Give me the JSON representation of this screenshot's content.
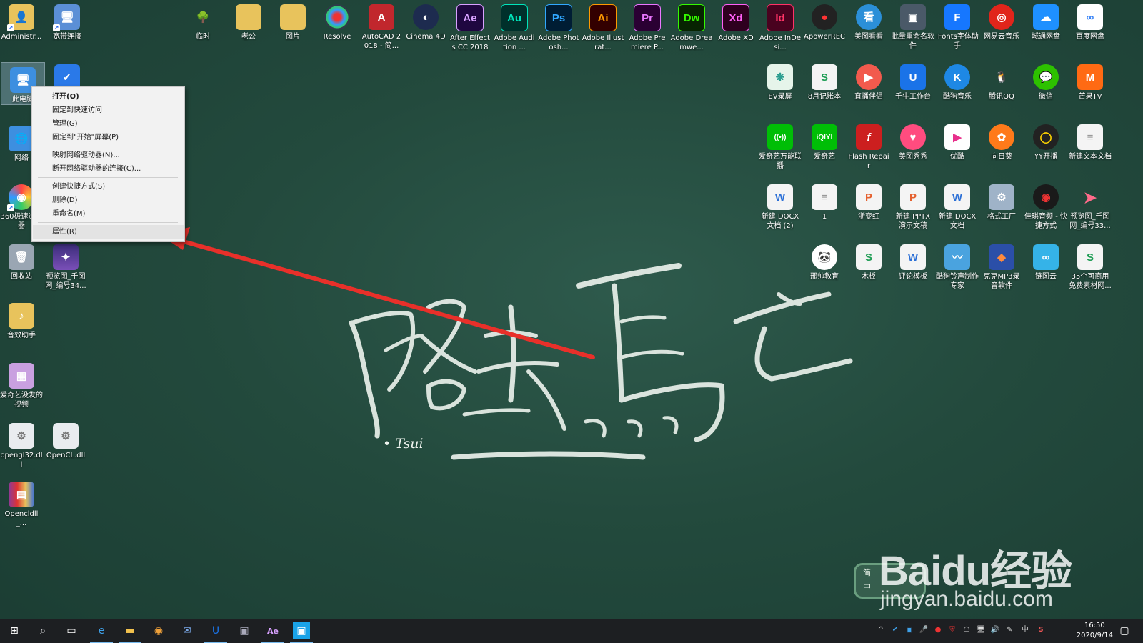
{
  "desktop_icons": [
    {
      "label": "Administr...",
      "name": "administrator-folder-icon",
      "color": "#e8c35c",
      "glyph": "👤"
    },
    {
      "label": "宽带连接",
      "name": "broadband-connection-icon",
      "color": "#5b8fd6",
      "glyph": "🖥"
    },
    {
      "label": "此电脑",
      "name": "this-pc-icon",
      "color": "#3d8fe0",
      "glyph": "🖥"
    },
    {
      "label": "网络",
      "name": "network-icon",
      "color": "#3d8fe0",
      "glyph": "🌐"
    },
    {
      "label": "360极速浏览器",
      "name": "360-browser-icon",
      "color": "#f0a13a",
      "glyph": "◉"
    },
    {
      "label": "回收站",
      "name": "recycle-bin-icon",
      "color": "#9aa6b3",
      "glyph": "🗑"
    },
    {
      "label": "预览图_千图网_编号34...",
      "name": "preview-image-galaxy-icon",
      "color": "#3b2d7a",
      "glyph": "✦"
    },
    {
      "label": "音效助手",
      "name": "sound-effect-folder-icon",
      "color": "#e8c35c",
      "glyph": "♪"
    },
    {
      "label": "爱奇艺没发的视频",
      "name": "iqiyi-videos-folder-icon",
      "color": "#c9a0e0",
      "glyph": "▦"
    },
    {
      "label": "opengl32.dll",
      "name": "opengl-dll-icon",
      "color": "#e9ecef",
      "glyph": "⚙"
    },
    {
      "label": "OpenCL.dll",
      "name": "opencl-dll-icon",
      "color": "#e9ecef",
      "glyph": "⚙"
    },
    {
      "label": "Opencldll_...",
      "name": "winrar-archive-icon",
      "color": "#8a3a9c",
      "glyph": "▤"
    },
    {
      "label": "",
      "name": "tencent-pc-manager-icon",
      "color": "#2a79e8",
      "glyph": "✓"
    },
    {
      "label": "临时",
      "name": "temp-tree-icon",
      "color": "#3f8d2e",
      "glyph": "🌳"
    },
    {
      "label": "老公",
      "name": "folder-laogong-icon",
      "color": "#e8c35c",
      "glyph": "▯"
    },
    {
      "label": "图片",
      "name": "folder-pictures-icon",
      "color": "#e8c35c",
      "glyph": "▯"
    },
    {
      "label": "Resolve",
      "name": "davinci-resolve-icon",
      "color": "#2f3a4a",
      "glyph": "◎"
    },
    {
      "label": "AutoCAD 2018 - 简...",
      "name": "autocad-icon",
      "color": "#c1272d",
      "glyph": "A"
    },
    {
      "label": "Cinema 4D",
      "name": "cinema4d-icon",
      "color": "#1d2b4f",
      "glyph": "◐"
    },
    {
      "label": "After Effects CC 2018",
      "name": "after-effects-icon",
      "color": "#1f0740",
      "glyph": "Ae"
    },
    {
      "label": "Adobe Audition ...",
      "name": "audition-icon",
      "color": "#00302b",
      "glyph": "Au"
    },
    {
      "label": "Adobe Photosh...",
      "name": "photoshop-icon",
      "color": "#001d34",
      "glyph": "Ps"
    },
    {
      "label": "Adobe Illustrat...",
      "name": "illustrator-icon",
      "color": "#330000",
      "glyph": "Ai"
    },
    {
      "label": "Adobe Premiere P...",
      "name": "premiere-icon",
      "color": "#2a0033",
      "glyph": "Pr"
    },
    {
      "label": "Adobe Dreamwe...",
      "name": "dreamweaver-icon",
      "color": "#072401",
      "glyph": "Dw"
    },
    {
      "label": "Adobe XD",
      "name": "adobe-xd-icon",
      "color": "#2e001f",
      "glyph": "Xd"
    },
    {
      "label": "Adobe InDesi...",
      "name": "indesign-icon",
      "color": "#49021f",
      "glyph": "Id"
    },
    {
      "label": "ApowerREC",
      "name": "apowerrec-icon",
      "color": "#222222",
      "glyph": "●"
    },
    {
      "label": "美图看看",
      "name": "meitu-viewer-icon",
      "color": "#2b8fd8",
      "glyph": "看"
    },
    {
      "label": "批量重命名软件",
      "name": "batch-rename-icon",
      "color": "#4a5968",
      "glyph": "▣"
    },
    {
      "label": "iFonts字体助手",
      "name": "ifonts-icon",
      "color": "#1677ff",
      "glyph": "F"
    },
    {
      "label": "网易云音乐",
      "name": "netease-music-icon",
      "color": "#e1251b",
      "glyph": "◎"
    },
    {
      "label": "城通网盘",
      "name": "ctfile-icon",
      "color": "#1e90ff",
      "glyph": "☁"
    },
    {
      "label": "百度网盘",
      "name": "baidu-netdisk-icon",
      "color": "#ffffff",
      "glyph": "∞"
    },
    {
      "label": "EV录屏",
      "name": "ev-recorder-icon",
      "color": "#e6f4ea",
      "glyph": "❋"
    },
    {
      "label": "8月记账本",
      "name": "ledger-xlsx-icon",
      "color": "#f4f4f4",
      "glyph": "S"
    },
    {
      "label": "直播伴侣",
      "name": "live-companion-icon",
      "color": "#f25a4d",
      "glyph": "▶"
    },
    {
      "label": "千牛工作台",
      "name": "qianniu-icon",
      "color": "#1a73e8",
      "glyph": "U"
    },
    {
      "label": "酷狗音乐",
      "name": "kugou-icon",
      "color": "#1e88e5",
      "glyph": "K"
    },
    {
      "label": "腾讯QQ",
      "name": "qq-icon",
      "color": "#111111",
      "glyph": "🐧"
    },
    {
      "label": "微信",
      "name": "wechat-icon",
      "color": "#2dc100",
      "glyph": "💬"
    },
    {
      "label": "芒果TV",
      "name": "mango-tv-icon",
      "color": "#ff6a13",
      "glyph": "M"
    },
    {
      "label": "爱奇艺万能联播",
      "name": "iqiyi-liantbo-icon",
      "color": "#00be06",
      "glyph": "((•))"
    },
    {
      "label": "爱奇艺",
      "name": "iqiyi-icon",
      "color": "#00be06",
      "glyph": "iQIYI"
    },
    {
      "label": "Flash Repair",
      "name": "flash-repair-icon",
      "color": "#cc1f1f",
      "glyph": "f"
    },
    {
      "label": "美图秀秀",
      "name": "meitu-xiuxiu-icon",
      "color": "#ff4c7f",
      "glyph": "♥"
    },
    {
      "label": "优酷",
      "name": "youku-icon",
      "color": "#ffffff",
      "glyph": "▶"
    },
    {
      "label": "向日葵",
      "name": "sunflower-icon",
      "color": "#ff7a1a",
      "glyph": "✿"
    },
    {
      "label": "YY开播",
      "name": "yy-live-icon",
      "color": "#222222",
      "glyph": "◯"
    },
    {
      "label": "新建文本文档",
      "name": "new-text-document-icon",
      "color": "#f4f4f4",
      "glyph": "≡"
    },
    {
      "label": "新建 DOCX 文档 (2)",
      "name": "docx-file-2-icon",
      "color": "#f4f4f4",
      "glyph": "W"
    },
    {
      "label": "1",
      "name": "text-file-1-icon",
      "color": "#f4f4f4",
      "glyph": "≡"
    },
    {
      "label": "浙变红",
      "name": "pptx-zhebianhong-icon",
      "color": "#f4f4f4",
      "glyph": "P"
    },
    {
      "label": "新建 PPTX 演示文稿",
      "name": "new-pptx-icon",
      "color": "#f4f4f4",
      "glyph": "P"
    },
    {
      "label": "新建 DOCX 文档",
      "name": "new-docx-icon",
      "color": "#f4f4f4",
      "glyph": "W"
    },
    {
      "label": "格式工厂",
      "name": "format-factory-icon",
      "color": "#9fb3c8",
      "glyph": "⚙"
    },
    {
      "label": "佳琪音频 - 快捷方式",
      "name": "audio-shortcut-icon",
      "color": "#1a1a1a",
      "glyph": "◉"
    },
    {
      "label": "预览图_千图网_编号33...",
      "name": "preview-image-brush-icon",
      "color": "#ff6b8a",
      "glyph": "➤"
    },
    {
      "label": "邢帅教育",
      "name": "xingshuai-edu-icon",
      "color": "#ffffff",
      "glyph": "🐼"
    },
    {
      "label": "木板",
      "name": "muban-xlsx-icon",
      "color": "#f4f4f4",
      "glyph": "S"
    },
    {
      "label": "评论模板",
      "name": "comment-template-docx-icon",
      "color": "#f4f4f4",
      "glyph": "W"
    },
    {
      "label": "酷狗铃声制作专家",
      "name": "kugou-ringtone-icon",
      "color": "#4aa3df",
      "glyph": "〰"
    },
    {
      "label": "克克MP3录音软件",
      "name": "mp3-recorder-icon",
      "color": "#2b4fa8",
      "glyph": "◆"
    },
    {
      "label": "链图云",
      "name": "liantuyun-icon",
      "color": "#35b3e8",
      "glyph": "∞"
    },
    {
      "label": "35个可商用免费素材网...",
      "name": "materials-xlsx-icon",
      "color": "#f4f4f4",
      "glyph": "S"
    }
  ],
  "context_menu": {
    "items": [
      "打开(O)",
      "固定到快速访问",
      "管理(G)",
      "固定到\"开始\"屏幕(P)",
      "映射网络驱动器(N)...",
      "断开网络驱动器的连接(C)...",
      "创建快捷方式(S)",
      "删除(D)",
      "重命名(M)",
      "属性(R)"
    ]
  },
  "wallpaper": {
    "signature": "• Tsui",
    "accent_arrow": "#e8302a"
  },
  "watermark": {
    "brand": "Baidu经验",
    "url": "jingyan.baidu.com"
  },
  "ime": {
    "top": "简",
    "bottom": "中"
  },
  "taskbar": {
    "buttons": [
      {
        "name": "start-button",
        "glyph": "⊞"
      },
      {
        "name": "search-button",
        "glyph": "⌕"
      },
      {
        "name": "task-view-button",
        "glyph": "▭"
      },
      {
        "name": "taskbar-edge-icon",
        "glyph": "e"
      },
      {
        "name": "taskbar-file-explorer-icon",
        "glyph": "▬"
      },
      {
        "name": "taskbar-360-browser-icon",
        "glyph": "◉"
      },
      {
        "name": "taskbar-mail-icon",
        "glyph": "✉"
      },
      {
        "name": "taskbar-qianniu-icon",
        "glyph": "U"
      },
      {
        "name": "taskbar-network-app-icon",
        "glyph": "▣"
      },
      {
        "name": "taskbar-after-effects-icon",
        "glyph": "Ae"
      },
      {
        "name": "taskbar-active-window-icon",
        "glyph": "▣"
      }
    ],
    "tray": [
      "^",
      "✔",
      "▣",
      "🎤",
      "●",
      "⛨",
      "☖",
      "🖥",
      "🔊",
      "✎",
      "中",
      "S"
    ],
    "time": "16:50",
    "date": "2020/9/14"
  }
}
